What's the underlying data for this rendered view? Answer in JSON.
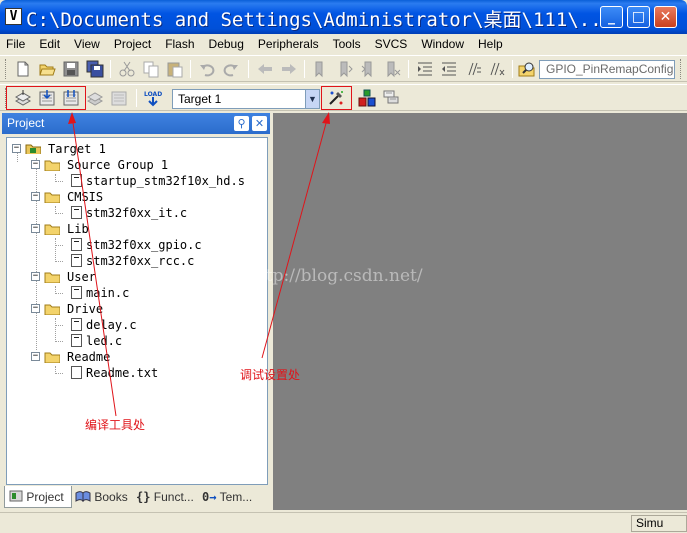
{
  "window": {
    "title": "C:\\Documents and Settings\\Administrator\\桌面\\111\\...",
    "minimize": "_",
    "maximize": "□",
    "close": "✕"
  },
  "menu": [
    "File",
    "Edit",
    "View",
    "Project",
    "Flash",
    "Debug",
    "Peripherals",
    "Tools",
    "SVCS",
    "Window",
    "Help"
  ],
  "toolbar": {
    "find_combo_value": "GPIO_PinRemapConfig",
    "target_select": "Target 1",
    "load_label": "LOAD"
  },
  "panel": {
    "title": "Project",
    "tree": [
      {
        "label": "Target 1",
        "type": "target"
      },
      {
        "label": "Source Group 1",
        "type": "group"
      },
      {
        "label": "startup_stm32f10x_hd.s",
        "type": "file"
      },
      {
        "label": "CMSIS",
        "type": "group"
      },
      {
        "label": "stm32f0xx_it.c",
        "type": "file"
      },
      {
        "label": "Lib",
        "type": "group"
      },
      {
        "label": "stm32f0xx_gpio.c",
        "type": "file"
      },
      {
        "label": "stm32f0xx_rcc.c",
        "type": "file"
      },
      {
        "label": "User",
        "type": "group"
      },
      {
        "label": "main.c",
        "type": "file"
      },
      {
        "label": "Drive",
        "type": "group"
      },
      {
        "label": "delay.c",
        "type": "file"
      },
      {
        "label": "led.c",
        "type": "file"
      },
      {
        "label": "Readme",
        "type": "group"
      },
      {
        "label": "Readme.txt",
        "type": "file"
      }
    ],
    "tabs": [
      "Project",
      "Books",
      "Funct...",
      "Tem..."
    ]
  },
  "status": {
    "mode": "Simu"
  },
  "annotations": {
    "watermark": "http://blog.csdn.net/",
    "compile_tools": "编译工具处",
    "debug_settings": "调试设置处"
  },
  "colors": {
    "annotation_red": "#e0141a",
    "editor_gray": "#808080",
    "titlebar_blue": "#0054e3"
  }
}
